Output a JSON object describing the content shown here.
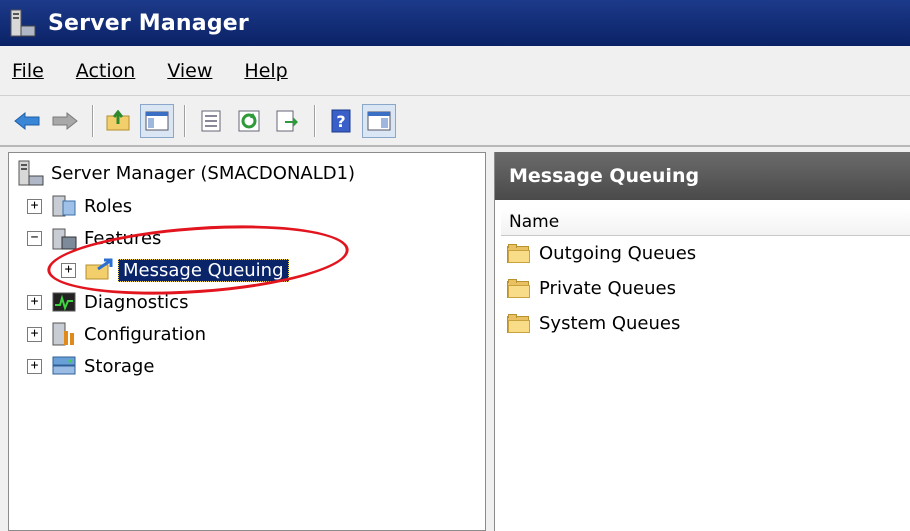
{
  "window": {
    "title": "Server Manager"
  },
  "menu": [
    {
      "label": "File"
    },
    {
      "label": "Action"
    },
    {
      "label": "View"
    },
    {
      "label": "Help"
    }
  ],
  "toolbar": {
    "buttons": [
      {
        "icon": "back-arrow-icon"
      },
      {
        "icon": "forward-arrow-icon"
      },
      {
        "icon": "up-folder-icon"
      },
      {
        "icon": "show-hide-console-tree-icon"
      },
      {
        "icon": "properties-icon"
      },
      {
        "icon": "refresh-icon"
      },
      {
        "icon": "export-list-icon"
      },
      {
        "icon": "help-icon"
      },
      {
        "icon": "show-hide-action-pane-icon"
      }
    ]
  },
  "tree": {
    "root": "Server Manager (SMACDONALD1)",
    "nodes": [
      {
        "label": "Roles",
        "expander": "+"
      },
      {
        "label": "Features",
        "expander": "−"
      },
      {
        "label": "Message Queuing",
        "expander": "+",
        "selected": true
      },
      {
        "label": "Diagnostics",
        "expander": "+"
      },
      {
        "label": "Configuration",
        "expander": "+"
      },
      {
        "label": "Storage",
        "expander": "+"
      }
    ]
  },
  "details": {
    "header": "Message Queuing",
    "column": "Name",
    "items": [
      {
        "label": "Outgoing Queues"
      },
      {
        "label": "Private Queues"
      },
      {
        "label": "System Queues"
      }
    ]
  },
  "colors": {
    "titlebar": "#0b2266",
    "selection": "#0a246a",
    "highlight_circle": "#e2141e",
    "pane_header": "#4a4a4a"
  }
}
